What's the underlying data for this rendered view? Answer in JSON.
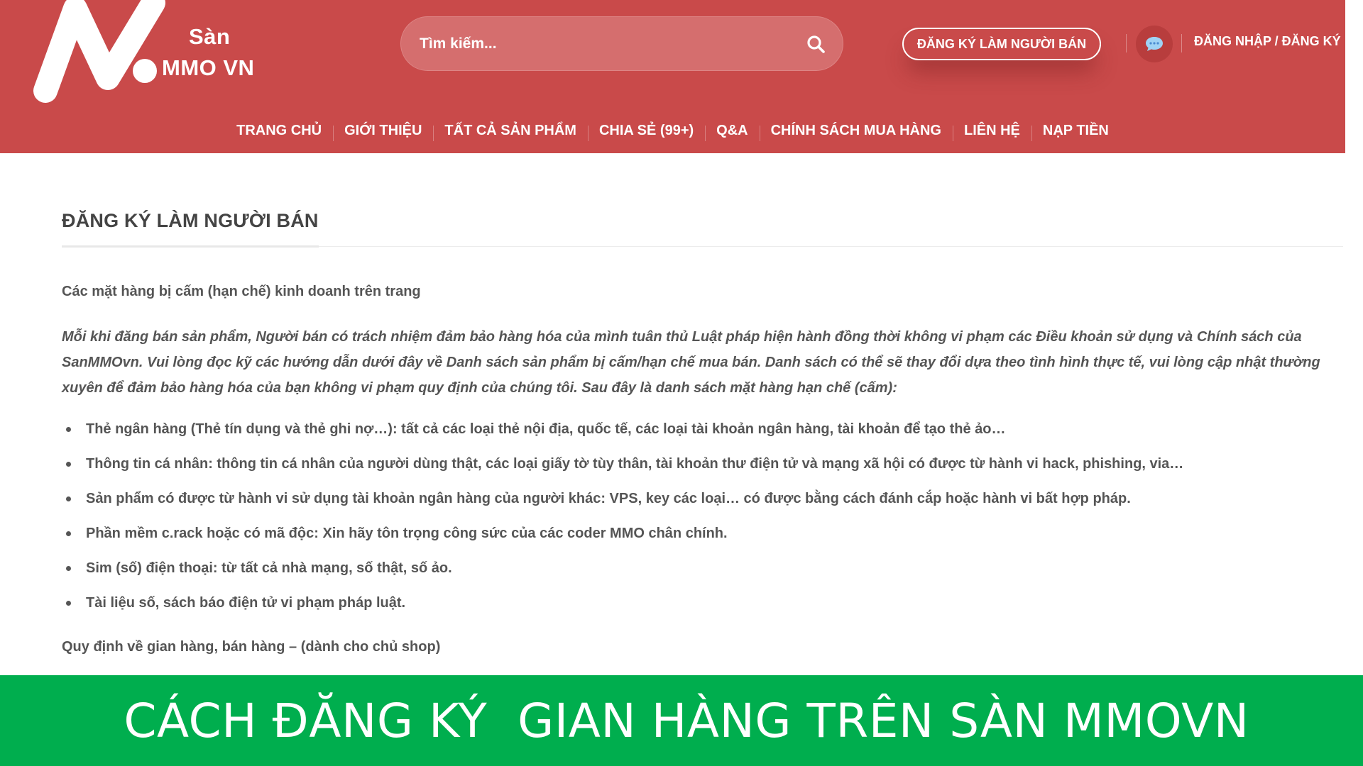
{
  "header": {
    "logo": {
      "line1": "Sàn",
      "line2": "MMO VN"
    },
    "search": {
      "placeholder": "Tìm kiếm..."
    },
    "seller_button": "ĐĂNG KÝ LÀM NGƯỜI BÁN",
    "chat_icon": "chat-bubble-icon",
    "login_link": "ĐĂNG NHẬP / ĐĂNG KÝ",
    "colors": {
      "background": "#c94a4a",
      "search_bg": "#d56e6e",
      "text": "#ffffff"
    }
  },
  "nav": {
    "items": [
      {
        "label": "TRANG CHỦ"
      },
      {
        "label": "GIỚI THIỆU"
      },
      {
        "label": "TẤT CẢ SẢN PHẨM"
      },
      {
        "label": "CHIA SẺ (99+)"
      },
      {
        "label": "Q&A"
      },
      {
        "label": "CHÍNH SÁCH MUA HÀNG"
      },
      {
        "label": "LIÊN HỆ"
      },
      {
        "label": "NẠP TIỀN"
      }
    ]
  },
  "content": {
    "title": "ĐĂNG KÝ LÀM NGƯỜI BÁN",
    "section_heading": "Các mặt hàng bị cấm (hạn chế) kinh doanh trên trang",
    "intro": "Mỗi khi đăng bán sản phẩm, Người bán có trách nhiệm đảm bảo hàng hóa của mình tuân thủ Luật pháp hiện hành đồng thời không vi phạm các Điều khoản sử dụng và Chính sách của SanMMOvn. Vui lòng đọc kỹ các hướng dẫn dưới đây về Danh sách sản phẩm bị cấm/hạn chế mua bán. Danh sách có thể sẽ thay đổi dựa theo tình hình thực tế, vui lòng cập nhật thường xuyên để đảm bảo hàng hóa của bạn không vi phạm quy định của chúng tôi. Sau đây là danh sách mặt hàng hạn chế (cấm):",
    "rules": [
      "Thẻ ngân hàng (Thẻ tín dụng và thẻ ghi nợ…): tất cả các loại thẻ nội địa, quốc tế, các loại tài khoản ngân hàng, tài khoản để tạo thẻ ảo…",
      "Thông tin cá nhân: thông tin cá nhân của người dùng thật, các loại giấy tờ tùy thân, tài khoản thư điện tử và mạng xã hội có được từ hành vi hack, phishing, via…",
      "Sản phẩm có được từ hành vi sử dụng tài khoản ngân hàng của người khác: VPS, key các loại… có được bằng cách đánh cắp hoặc hành vi bất hợp pháp.",
      "Phần mềm c.rack hoặc có mã độc: Xin hãy tôn trọng công sức của các coder MMO chân chính.",
      "Sim (số) điện thoại: từ tất cả nhà mạng, số thật, số ảo.",
      "Tài liệu số, sách báo điện tử vi phạm pháp luật."
    ],
    "section_heading_2": "Quy định về gian hàng, bán hàng – (dành cho chủ shop)"
  },
  "banner": {
    "text": "CÁCH ĐĂNG KÝ  GIAN HÀNG TRÊN SÀN MMOVN",
    "background": "#00ae4e"
  }
}
